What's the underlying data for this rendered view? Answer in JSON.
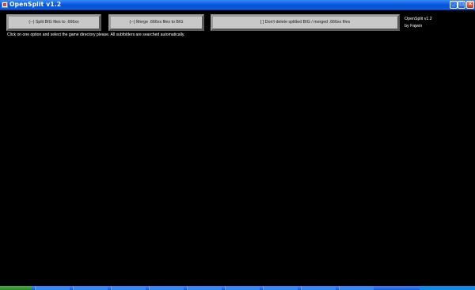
{
  "window": {
    "title": "OpenSplit v1.2"
  },
  "buttons": {
    "split_label": "(--) Split BIG files to .666xx",
    "merge_label": "(--) Merge .666xx files to BIG",
    "dont_delete_label": "[ ] Don't delete splitted BIG / merged .666xx files"
  },
  "info_text": "Click on one option and select the game directory please. All subfolders are searched automatically.",
  "version": {
    "line1": "OpenSplit v1.2",
    "line2": "by Fajwin"
  },
  "icons": {
    "app": "app-icon",
    "minimize": "minimize-icon",
    "maximize": "maximize-icon",
    "close": "close-icon"
  },
  "colors": {
    "background": "#000000",
    "titlebar": "#0a5ee0",
    "button_face": "#c8c8c8",
    "text": "#ffffff"
  }
}
